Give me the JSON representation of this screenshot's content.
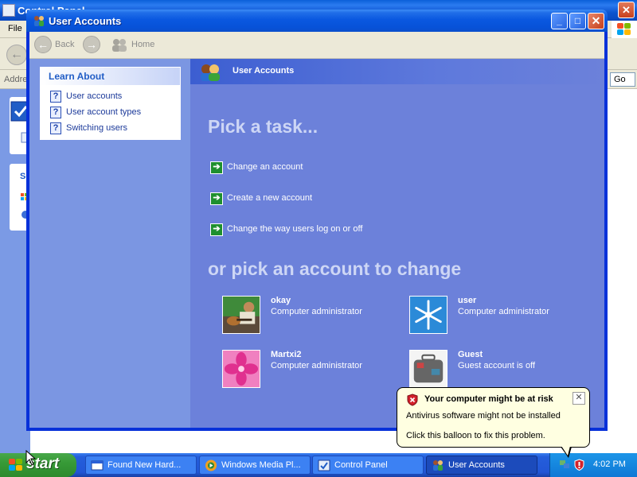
{
  "background_window": {
    "title": "Control Panel",
    "menu_file": "File",
    "address_label": "Address",
    "go_label": "Go",
    "see_also_label": "Se"
  },
  "window": {
    "title": "User Accounts",
    "minimize": "_",
    "maximize": "□",
    "close": "✕"
  },
  "toolbar": {
    "back_label": "Back",
    "home_label": "Home"
  },
  "learn_about": {
    "header": "Learn About",
    "items": [
      {
        "label": "User accounts",
        "icon": "help-icon"
      },
      {
        "label": "User account types",
        "icon": "help-icon"
      },
      {
        "label": "Switching users",
        "icon": "help-icon"
      }
    ]
  },
  "main": {
    "banner_title": "User Accounts",
    "pick_task_heading": "Pick a task...",
    "tasks": [
      {
        "label": "Change an account",
        "icon": "green-arrow-icon"
      },
      {
        "label": "Create a new account",
        "icon": "green-arrow-icon"
      },
      {
        "label": "Change the way users log on or off",
        "icon": "green-arrow-icon"
      }
    ],
    "pick_account_heading": "or pick an account to change",
    "accounts": [
      {
        "name": "okay",
        "type": "Computer administrator",
        "picture": "guitar-photo"
      },
      {
        "name": "user",
        "type": "Computer administrator",
        "picture": "snowflake"
      },
      {
        "name": "Martxi2",
        "type": "Computer administrator",
        "picture": "pink-flower"
      },
      {
        "name": "Guest",
        "type": "Guest account is off",
        "picture": "suitcase"
      }
    ]
  },
  "balloon": {
    "title": "Your computer might be at risk",
    "line1": "Antivirus software might not be installed",
    "line2": "Click this balloon to fix this problem.",
    "close": "✕"
  },
  "taskbar": {
    "start_label": "start",
    "buttons": [
      {
        "label": "Found New Hard...",
        "active": false
      },
      {
        "label": "Windows Media Pl...",
        "active": false
      },
      {
        "label": "Control Panel",
        "active": false
      },
      {
        "label": "User Accounts",
        "active": true
      }
    ],
    "clock": "4:02 PM"
  },
  "colors": {
    "taskbar_blue": "#245edb",
    "start_green": "#379a37",
    "task_pane": "#6c81da",
    "left_pane": "#7b96e2",
    "balloon_bg": "#ffffe1",
    "task_arrow": "#1e8f2e"
  }
}
